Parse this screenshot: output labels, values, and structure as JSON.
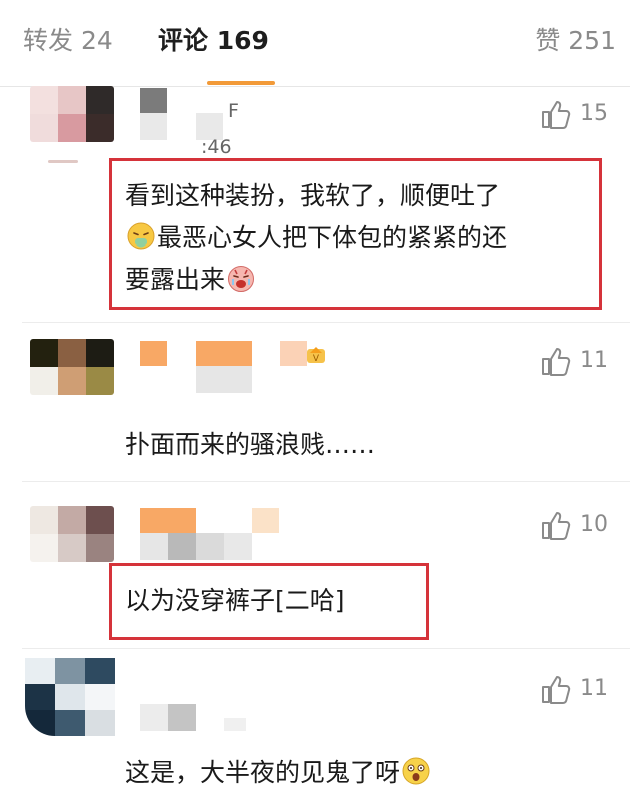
{
  "tabs": {
    "repost": "转发 24",
    "comments": "评论 169",
    "likes": "赞 251"
  },
  "colors": {
    "accent": "#f29a38",
    "highlight_box": "#d5333a",
    "muted_text": "#8a8a8a"
  },
  "comments": [
    {
      "time_fragment": ":46",
      "name_fragment": "F",
      "likes": "15",
      "text_lines": [
        "看到这种装扮，我软了，顺便吐了",
        "最恶心女人把下体包的紧紧的还",
        "要露出来"
      ],
      "emojis": [
        "vomit-emoji",
        "cry-emoji"
      ]
    },
    {
      "likes": "11",
      "text_lines": [
        "扑面而来的骚浪贱……"
      ],
      "badge": "vip-badge-icon"
    },
    {
      "likes": "10",
      "text_lines": [
        "以为没穿裤子[二哈]"
      ]
    },
    {
      "likes": "11",
      "text_lines": [
        "这是，大半夜的见鬼了呀"
      ],
      "emojis": [
        "shocked-emoji"
      ]
    }
  ]
}
